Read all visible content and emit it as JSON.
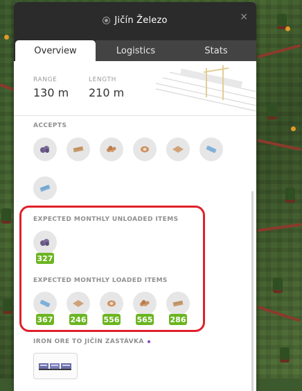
{
  "window": {
    "title": "Jičín Železo",
    "close_icon": "close-icon",
    "station_icon": "station-icon"
  },
  "tabs": [
    {
      "label": "Overview",
      "active": true
    },
    {
      "label": "Logistics",
      "active": false
    },
    {
      "label": "Stats",
      "active": false
    }
  ],
  "summary": {
    "range_label": "RANGE",
    "range_value": "130 m",
    "length_label": "LENGTH",
    "length_value": "210 m"
  },
  "accepts": {
    "label": "ACCEPTS",
    "items": [
      {
        "icon": "ore-icon",
        "color": "#6a5a86"
      },
      {
        "icon": "wood-planks-icon",
        "color": "#c89a6a"
      },
      {
        "icon": "logs-icon",
        "color": "#c88a5c"
      },
      {
        "icon": "barrel-icon",
        "color": "#cf9262"
      },
      {
        "icon": "plank-icon",
        "color": "#d0a27a"
      },
      {
        "icon": "steel-icon",
        "color": "#7fb0d8"
      },
      {
        "icon": "steel-bars-icon",
        "color": "#7fb0d8"
      }
    ]
  },
  "unloaded": {
    "label": "EXPECTED MONTHLY UNLOADED ITEMS",
    "items": [
      {
        "icon": "ore-icon",
        "color": "#6a5a86",
        "count": "327"
      }
    ]
  },
  "loaded": {
    "label": "EXPECTED MONTHLY LOADED ITEMS",
    "items": [
      {
        "icon": "steel-icon",
        "color": "#7fb0d8",
        "count": "367"
      },
      {
        "icon": "plank-icon",
        "color": "#d0a27a",
        "count": "246"
      },
      {
        "icon": "barrel-icon",
        "color": "#cf9262",
        "count": "556"
      },
      {
        "icon": "logs-icon",
        "color": "#c88a5c",
        "count": "565"
      },
      {
        "icon": "wood-planks-icon",
        "color": "#c89a6a",
        "count": "286"
      }
    ]
  },
  "route": {
    "label": "IRON ORE TO JIČÍN ZASTÁVKA",
    "train_icon": "train-icon"
  },
  "colors": {
    "badge": "#6bb520",
    "highlight": "#e0202a",
    "header": "#2b2b2b"
  }
}
